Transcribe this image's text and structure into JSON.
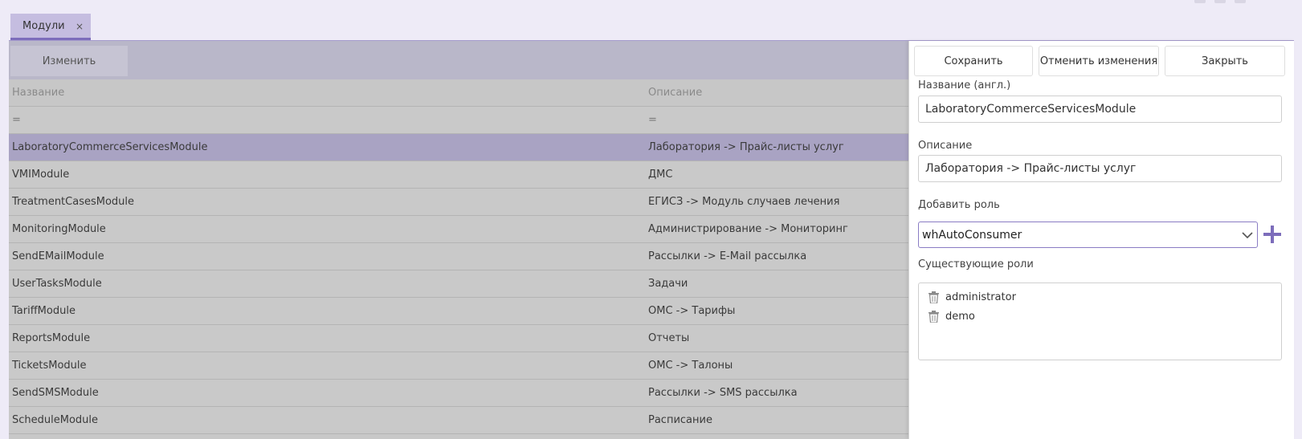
{
  "tabs": [
    {
      "label": "Модули",
      "close": "×"
    }
  ],
  "toolbar": {
    "edit_label": "Изменить"
  },
  "table": {
    "headers": {
      "name": "Название",
      "description": "Описание"
    },
    "filter": {
      "name": "=",
      "description": "="
    },
    "rows": [
      {
        "name": "LaboratoryCommerceServicesModule",
        "description": "Лаборатория -> Прайс-листы услуг"
      },
      {
        "name": "VMIModule",
        "description": "ДМС"
      },
      {
        "name": "TreatmentCasesModule",
        "description": "ЕГИСЗ -> Модуль случаев лечения"
      },
      {
        "name": "MonitoringModule",
        "description": "Администрирование -> Мониторинг"
      },
      {
        "name": "SendEMailModule",
        "description": "Рассылки -> E-Mail рассылка"
      },
      {
        "name": "UserTasksModule",
        "description": "Задачи"
      },
      {
        "name": "TariffModule",
        "description": "ОМС -> Тарифы"
      },
      {
        "name": "ReportsModule",
        "description": "Отчеты"
      },
      {
        "name": "TicketsModule",
        "description": "ОМС -> Талоны"
      },
      {
        "name": "SendSMSModule",
        "description": "Рассылки -> SMS рассылка"
      },
      {
        "name": "ScheduleModule",
        "description": "Расписание"
      }
    ]
  },
  "panel": {
    "buttons": {
      "save": "Сохранить",
      "cancel": "Отменить изменения",
      "close": "Закрыть"
    },
    "name_label": "Название (англ.)",
    "name_value": "LaboratoryCommerceServicesModule",
    "desc_label": "Описание",
    "desc_value": "Лаборатория -> Прайс-листы услуг",
    "add_role_label": "Добавить роль",
    "add_role_value": "whAutoConsumer",
    "existing_roles_label": "Существующие роли",
    "roles": [
      "administrator",
      "demo"
    ]
  },
  "colors": {
    "accent": "#7d6dbb",
    "selected_row": "#a9a3c3",
    "toolbar": "#b9b7c9"
  }
}
